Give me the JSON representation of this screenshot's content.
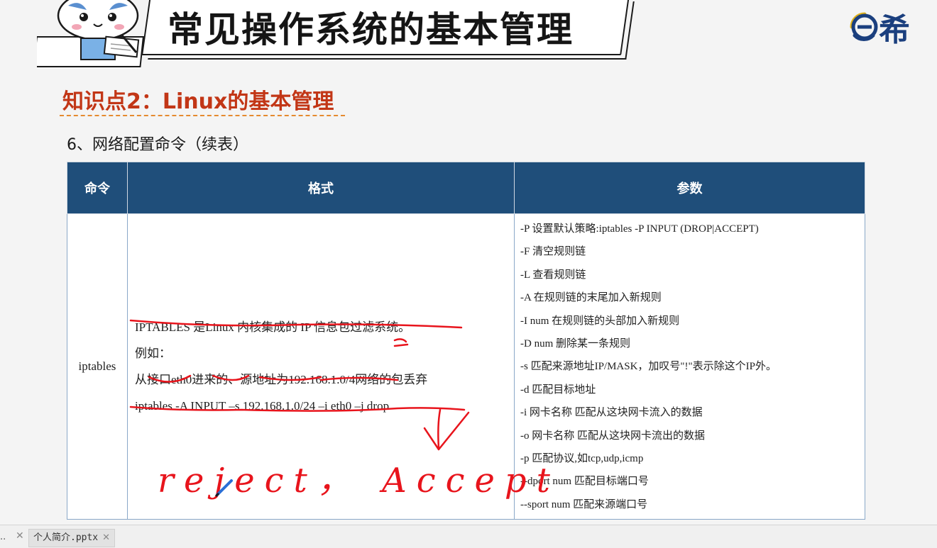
{
  "slide": {
    "title": "常见操作系统的基本管理",
    "logo_text": "希",
    "section_title": "知识点2：Linux的基本管理",
    "subtitle": "6、网络配置命令（续表）"
  },
  "table": {
    "headers": [
      "命令",
      "格式",
      "参数"
    ],
    "command": "iptables",
    "format_lines": [
      "IPTABLES 是Linux 内核集成的 IP 信息包过滤系统。",
      "例如：",
      "从接口eth0进来的、源地址为192.168.1.0/4网络的包丢弃",
      "iptables -A INPUT  –s 192.168.1.0/24  –i eth0 –j drop"
    ],
    "params": [
      "-P 设置默认策略:iptables -P INPUT (DROP|ACCEPT)",
      "-F 清空规则链",
      "-L 查看规则链",
      "-A 在规则链的末尾加入新规则",
      "-I num 在规则链的头部加入新规则",
      "-D num 删除某一条规则",
      "-s 匹配来源地址IP/MASK，加叹号\"!\"表示除这个IP外。",
      "-d 匹配目标地址",
      "-i 网卡名称 匹配从这块网卡流入的数据",
      "-o 网卡名称 匹配从这块网卡流出的数据",
      "-p 匹配协议,如tcp,udp,icmp",
      "--dport num 匹配目标端口号",
      "--sport num 匹配来源端口号"
    ]
  },
  "annotations": {
    "handwriting": "reject， Accept",
    "note_mark": "2",
    "ink_color": "#e8141c"
  },
  "tabbar": {
    "prev_tab": "..",
    "active_tab": "个人简介.pptx",
    "close_glyph": "✕"
  },
  "colors": {
    "header_bg": "#1f4e7a",
    "section_title": "#c23616",
    "dash": "#e58a2f"
  }
}
